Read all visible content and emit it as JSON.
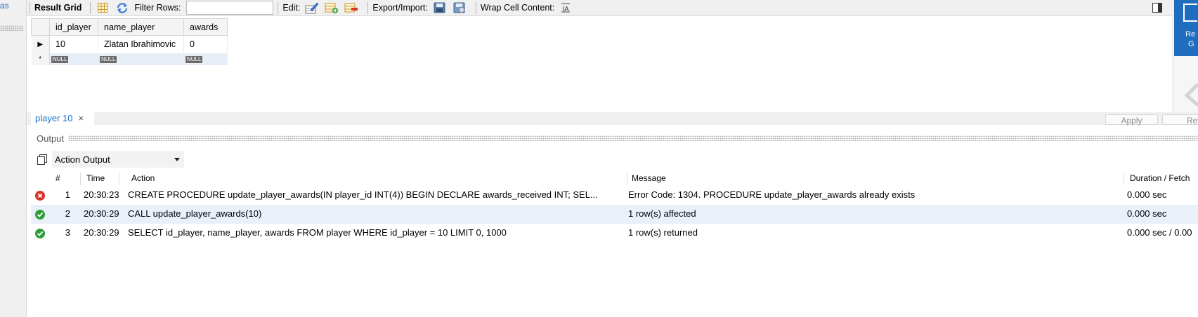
{
  "left": {
    "fragment": "as"
  },
  "toolbar": {
    "result_grid": "Result Grid",
    "filter_rows": "Filter Rows:",
    "filter_value": "",
    "edit": "Edit:",
    "export_import": "Export/Import:",
    "wrap_cell_content": "Wrap Cell Content:",
    "wrap_icon_glyph": "̲I̲A"
  },
  "grid": {
    "columns": [
      "id_player",
      "name_player",
      "awards"
    ],
    "rows": [
      {
        "id_player": "10",
        "name_player": "Zlatan Ibrahimovic",
        "awards": "0"
      }
    ],
    "null_label": "NULL",
    "new_row_marker": "*",
    "current_row_marker": "▶"
  },
  "right_panel": {
    "label_line1": "Re",
    "label_line2": "G"
  },
  "tabs": {
    "query_tab": "player 10",
    "close_glyph": "×",
    "apply": "Apply",
    "revert": "Rev"
  },
  "output": {
    "title": "Output",
    "selector": "Action Output",
    "columns": {
      "num": "#",
      "time": "Time",
      "action": "Action",
      "message": "Message",
      "duration": "Duration / Fetch"
    },
    "rows": [
      {
        "status": "error",
        "num": "1",
        "time": "20:30:23",
        "action": "CREATE PROCEDURE update_player_awards(IN player_id INT(4)) BEGIN   DECLARE awards_received INT;   SEL...",
        "message": "Error Code: 1304. PROCEDURE update_player_awards already exists",
        "duration": "0.000 sec"
      },
      {
        "status": "ok",
        "num": "2",
        "time": "20:30:29",
        "action": "CALL update_player_awards(10)",
        "message": "1 row(s) affected",
        "duration": "0.000 sec"
      },
      {
        "status": "ok",
        "num": "3",
        "time": "20:30:29",
        "action": "SELECT id_player, name_player, awards FROM player WHERE id_player = 10 LIMIT 0, 1000",
        "message": "1 row(s) returned",
        "duration": "0.000 sec / 0.00"
      }
    ]
  },
  "colors": {
    "accent_blue": "#1f6dbf",
    "error_red": "#d9342b",
    "ok_green": "#2f9e3a",
    "row_highlight": "#e9f0fa"
  }
}
